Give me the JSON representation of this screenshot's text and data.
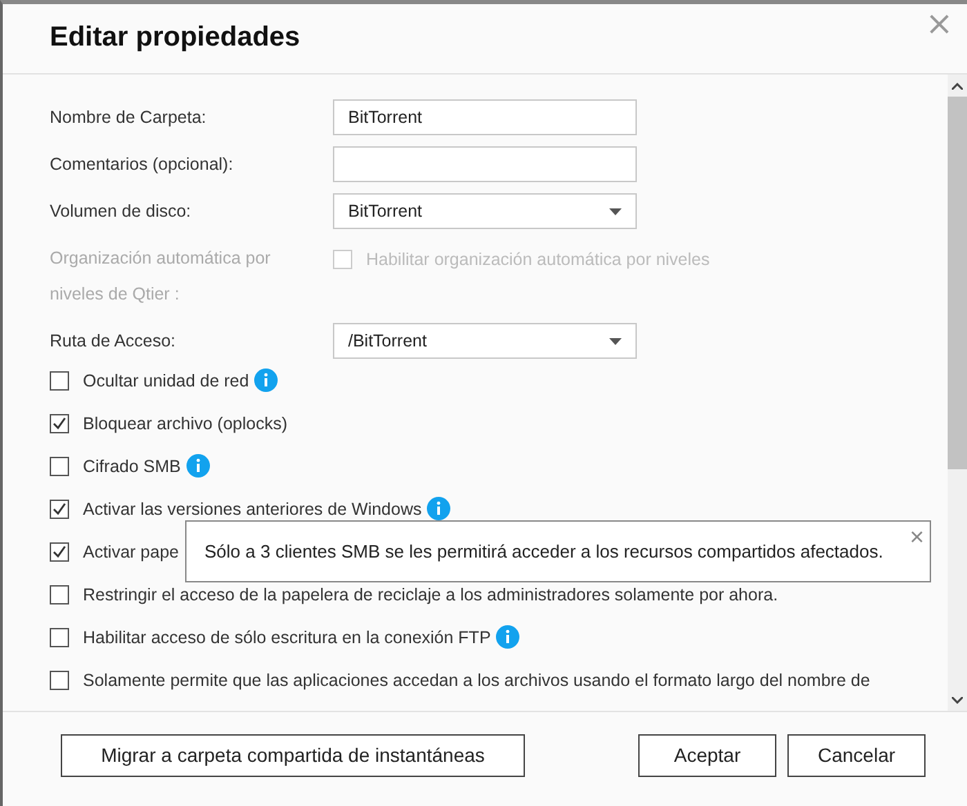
{
  "dialog": {
    "title": "Editar propiedades"
  },
  "fields": [
    {
      "kind": "text",
      "label": "Nombre de Carpeta:",
      "value": "BitTorrent"
    },
    {
      "kind": "text",
      "label": "Comentarios (opcional):"
    },
    {
      "kind": "select",
      "label": "Volumen de disco:",
      "value": "BitTorrent"
    },
    {
      "kind": "check",
      "label": "Organización automática por niveles de Qtier :",
      "option": "Habilitar organización automática por niveles",
      "checked": false,
      "disabled": true
    },
    {
      "kind": "select",
      "label": "Ruta de Acceso:",
      "value": "/BitTorrent"
    }
  ],
  "options": [
    {
      "label": "Ocultar unidad de red",
      "checked": false,
      "info": true
    },
    {
      "label": "Bloquear archivo (oplocks)",
      "checked": true,
      "info": false
    },
    {
      "label": "Cifrado SMB",
      "checked": false,
      "info": true
    },
    {
      "label": "Activar las versiones anteriores de Windows",
      "checked": true,
      "info": true
    },
    {
      "label": "Activar pape",
      "checked": true,
      "info": false
    },
    {
      "label": "Restringir el acceso de la papelera de reciclaje a los administradores solamente por ahora.",
      "checked": false,
      "info": false
    },
    {
      "label": "Habilitar acceso de sólo escritura en la conexión FTP",
      "checked": false,
      "info": true
    },
    {
      "label": "Solamente permite que las aplicaciones accedan a los archivos usando el formato largo del nombre de",
      "checked": false,
      "info": false
    }
  ],
  "tooltip": {
    "text": "Sólo a 3 clientes SMB se les permitirá acceder a los recursos compartidos afectados.",
    "close": "×"
  },
  "buttons": [
    {
      "label": "Migrar a carpeta compartida de instantáneas",
      "kind": "left"
    },
    {
      "label": "Aceptar",
      "kind": "right"
    },
    {
      "label": "Cancelar",
      "kind": "right"
    }
  ],
  "close": "×"
}
